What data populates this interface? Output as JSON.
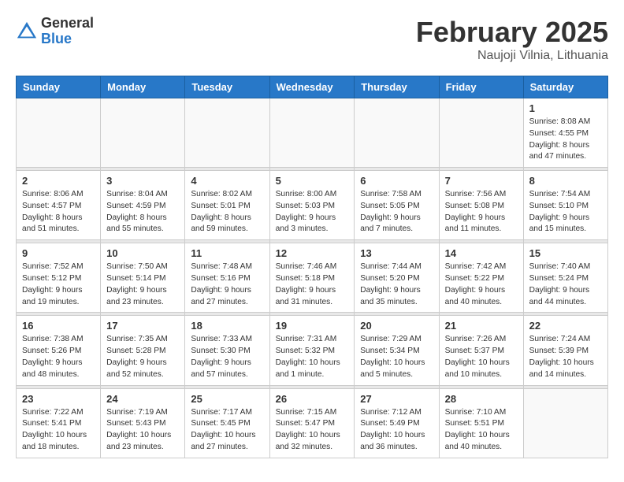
{
  "header": {
    "logo_general": "General",
    "logo_blue": "Blue",
    "month_title": "February 2025",
    "location": "Naujoji Vilnia, Lithuania"
  },
  "days_of_week": [
    "Sunday",
    "Monday",
    "Tuesday",
    "Wednesday",
    "Thursday",
    "Friday",
    "Saturday"
  ],
  "weeks": [
    [
      {
        "day": "",
        "info": ""
      },
      {
        "day": "",
        "info": ""
      },
      {
        "day": "",
        "info": ""
      },
      {
        "day": "",
        "info": ""
      },
      {
        "day": "",
        "info": ""
      },
      {
        "day": "",
        "info": ""
      },
      {
        "day": "1",
        "info": "Sunrise: 8:08 AM\nSunset: 4:55 PM\nDaylight: 8 hours and 47 minutes."
      }
    ],
    [
      {
        "day": "2",
        "info": "Sunrise: 8:06 AM\nSunset: 4:57 PM\nDaylight: 8 hours and 51 minutes."
      },
      {
        "day": "3",
        "info": "Sunrise: 8:04 AM\nSunset: 4:59 PM\nDaylight: 8 hours and 55 minutes."
      },
      {
        "day": "4",
        "info": "Sunrise: 8:02 AM\nSunset: 5:01 PM\nDaylight: 8 hours and 59 minutes."
      },
      {
        "day": "5",
        "info": "Sunrise: 8:00 AM\nSunset: 5:03 PM\nDaylight: 9 hours and 3 minutes."
      },
      {
        "day": "6",
        "info": "Sunrise: 7:58 AM\nSunset: 5:05 PM\nDaylight: 9 hours and 7 minutes."
      },
      {
        "day": "7",
        "info": "Sunrise: 7:56 AM\nSunset: 5:08 PM\nDaylight: 9 hours and 11 minutes."
      },
      {
        "day": "8",
        "info": "Sunrise: 7:54 AM\nSunset: 5:10 PM\nDaylight: 9 hours and 15 minutes."
      }
    ],
    [
      {
        "day": "9",
        "info": "Sunrise: 7:52 AM\nSunset: 5:12 PM\nDaylight: 9 hours and 19 minutes."
      },
      {
        "day": "10",
        "info": "Sunrise: 7:50 AM\nSunset: 5:14 PM\nDaylight: 9 hours and 23 minutes."
      },
      {
        "day": "11",
        "info": "Sunrise: 7:48 AM\nSunset: 5:16 PM\nDaylight: 9 hours and 27 minutes."
      },
      {
        "day": "12",
        "info": "Sunrise: 7:46 AM\nSunset: 5:18 PM\nDaylight: 9 hours and 31 minutes."
      },
      {
        "day": "13",
        "info": "Sunrise: 7:44 AM\nSunset: 5:20 PM\nDaylight: 9 hours and 35 minutes."
      },
      {
        "day": "14",
        "info": "Sunrise: 7:42 AM\nSunset: 5:22 PM\nDaylight: 9 hours and 40 minutes."
      },
      {
        "day": "15",
        "info": "Sunrise: 7:40 AM\nSunset: 5:24 PM\nDaylight: 9 hours and 44 minutes."
      }
    ],
    [
      {
        "day": "16",
        "info": "Sunrise: 7:38 AM\nSunset: 5:26 PM\nDaylight: 9 hours and 48 minutes."
      },
      {
        "day": "17",
        "info": "Sunrise: 7:35 AM\nSunset: 5:28 PM\nDaylight: 9 hours and 52 minutes."
      },
      {
        "day": "18",
        "info": "Sunrise: 7:33 AM\nSunset: 5:30 PM\nDaylight: 9 hours and 57 minutes."
      },
      {
        "day": "19",
        "info": "Sunrise: 7:31 AM\nSunset: 5:32 PM\nDaylight: 10 hours and 1 minute."
      },
      {
        "day": "20",
        "info": "Sunrise: 7:29 AM\nSunset: 5:34 PM\nDaylight: 10 hours and 5 minutes."
      },
      {
        "day": "21",
        "info": "Sunrise: 7:26 AM\nSunset: 5:37 PM\nDaylight: 10 hours and 10 minutes."
      },
      {
        "day": "22",
        "info": "Sunrise: 7:24 AM\nSunset: 5:39 PM\nDaylight: 10 hours and 14 minutes."
      }
    ],
    [
      {
        "day": "23",
        "info": "Sunrise: 7:22 AM\nSunset: 5:41 PM\nDaylight: 10 hours and 18 minutes."
      },
      {
        "day": "24",
        "info": "Sunrise: 7:19 AM\nSunset: 5:43 PM\nDaylight: 10 hours and 23 minutes."
      },
      {
        "day": "25",
        "info": "Sunrise: 7:17 AM\nSunset: 5:45 PM\nDaylight: 10 hours and 27 minutes."
      },
      {
        "day": "26",
        "info": "Sunrise: 7:15 AM\nSunset: 5:47 PM\nDaylight: 10 hours and 32 minutes."
      },
      {
        "day": "27",
        "info": "Sunrise: 7:12 AM\nSunset: 5:49 PM\nDaylight: 10 hours and 36 minutes."
      },
      {
        "day": "28",
        "info": "Sunrise: 7:10 AM\nSunset: 5:51 PM\nDaylight: 10 hours and 40 minutes."
      },
      {
        "day": "",
        "info": ""
      }
    ]
  ]
}
